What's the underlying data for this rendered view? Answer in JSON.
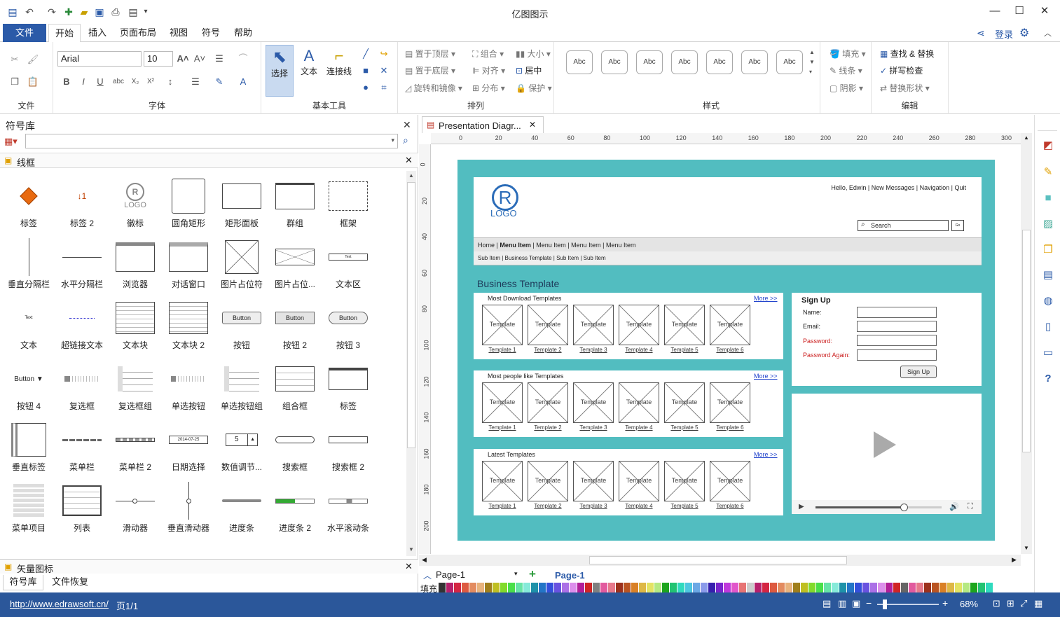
{
  "app": {
    "title": "亿图图示"
  },
  "menu": {
    "file": "文件",
    "tabs": [
      "开始",
      "插入",
      "页面布局",
      "视图",
      "符号",
      "帮助"
    ],
    "login": "登录"
  },
  "ribbon": {
    "groups": {
      "file": "文件",
      "font": "字体",
      "tools": "基本工具",
      "arrange": "排列",
      "style": "样式",
      "edit": "编辑"
    },
    "font_name": "Arial",
    "font_size": "10",
    "tools": {
      "select": "选择",
      "text": "文本",
      "connector": "连接线"
    },
    "arrange": {
      "top": "置于顶层",
      "bottom": "置于底层",
      "rotate": "旋转和镜像",
      "group": "组合",
      "align": "对齐",
      "distribute": "分布",
      "size": "大小",
      "center": "居中",
      "protect": "保护"
    },
    "style_label": "Abc",
    "fill": {
      "fill": "填充",
      "line": "线条",
      "shadow": "阴影"
    },
    "edit": {
      "find": "查找 & 替换",
      "spell": "拼写检查",
      "replace": "替换形状"
    }
  },
  "library": {
    "title": "符号库",
    "search_placeholder": "",
    "section1": "线框",
    "section2": "矢量图标",
    "shapes": [
      "标签",
      "标签 2",
      "徽标",
      "圆角矩形",
      "矩形面板",
      "群组",
      "框架",
      "垂直分隔栏",
      "水平分隔栏",
      "浏览器",
      "对话窗口",
      "图片占位符",
      "图片占位...",
      "文本区",
      "文本",
      "超链接文本",
      "文本块",
      "文本块 2",
      "按钮",
      "按钮 2",
      "按钮 3",
      "按钮 4",
      "复选框",
      "复选框组",
      "单选按钮",
      "单选按钮组",
      "组合框",
      "标签",
      "垂直标签",
      "菜单栏",
      "菜单栏 2",
      "日期选择",
      "数值调节...",
      "搜索框",
      "搜索框 2",
      "菜单项目",
      "列表",
      "滑动器",
      "垂直滑动器",
      "进度条",
      "进度条 2",
      "水平滚动条"
    ],
    "shape_samples": {
      "button": "Button",
      "button4": "Button ▼",
      "logo": "LOGO",
      "date": "2014-07-25",
      "num": "5",
      "text": "Text"
    },
    "bottom_tabs": [
      "符号库",
      "文件恢复"
    ]
  },
  "document": {
    "tab": "Presentation Diagr...",
    "ruler_h": [
      "0",
      "20",
      "40",
      "60",
      "80",
      "100",
      "120",
      "140",
      "160",
      "180",
      "200",
      "220",
      "240",
      "260",
      "280",
      "300"
    ],
    "ruler_v": [
      "0",
      "20",
      "40",
      "60",
      "80",
      "100",
      "120",
      "140",
      "160",
      "180",
      "200"
    ],
    "page_select": "Page-1",
    "page_tab": "Page-1",
    "fill_label": "填充"
  },
  "wireframe": {
    "logo": "LOGO",
    "logo_mark": "R",
    "top_links": [
      "Hello, Edwin",
      "New Messages",
      "Navigation",
      "Quit"
    ],
    "search": "Search",
    "go": "Go",
    "nav": [
      "Home",
      "Menu Item",
      "Menu Item",
      "Menu Item",
      "Menu Item"
    ],
    "subnav": [
      "Sub Item",
      "Business Template",
      "Sub Item",
      "Sub Item"
    ],
    "heading": "Business Template",
    "sections": [
      {
        "title": "Most Download Templates",
        "more": "More >>"
      },
      {
        "title": "Most people like Templates",
        "more": "More >>"
      },
      {
        "title": "Latest Templates",
        "more": "More >>"
      }
    ],
    "tpl_label": "Template",
    "tpl_names": [
      "Template 1",
      "Template 2",
      "Template 3",
      "Template 4",
      "Template 5",
      "Template 6"
    ],
    "signup": {
      "title": "Sign Up",
      "name": "Name:",
      "email": "Email:",
      "password": "Password:",
      "again": "Password Again:",
      "button": "Sign Up"
    },
    "video_progress": 0.7
  },
  "status": {
    "url": "http://www.edrawsoft.cn/",
    "page": "页1/1",
    "zoom": "68%"
  }
}
